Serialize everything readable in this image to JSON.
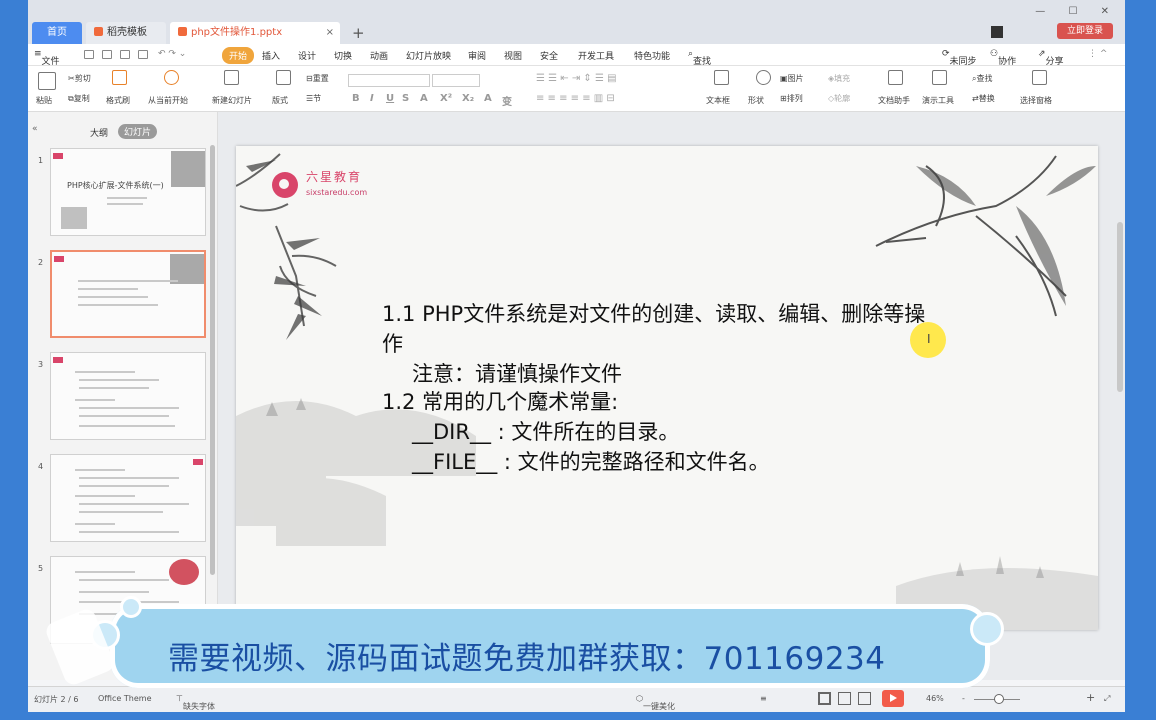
{
  "tabs": {
    "home": "首页",
    "template": "稻壳模板",
    "doc": "php文件操作1.pptx",
    "close": "×",
    "plus": "+"
  },
  "window": {
    "controls": "— ☐ ✕"
  },
  "login": "立即登录",
  "menu": {
    "file": "文件",
    "items": [
      "开始",
      "插入",
      "设计",
      "切换",
      "动画",
      "幻灯片放映",
      "审阅",
      "视图",
      "安全",
      "开发工具",
      "特色功能",
      "查找"
    ],
    "right": [
      "未同步",
      "协作",
      "分享"
    ]
  },
  "ribbon": {
    "paste": "粘贴",
    "cut": "剪切",
    "copy": "复制",
    "format_painter": "格式刷",
    "from_current": "从当前开始",
    "new_slide": "新建幻灯片",
    "layout": "版式",
    "reset": "重置",
    "section": "节",
    "font_buttons": [
      "B",
      "I",
      "U",
      "S",
      "A",
      "X²",
      "X₂",
      "A",
      "变"
    ],
    "textbox": "文本框",
    "shape": "形状",
    "picture": "图片",
    "fill": "填充",
    "arrange": "排列",
    "outline": "轮廓",
    "doc_assist": "文档助手",
    "presenter": "演示工具",
    "find": "查找",
    "replace": "替换",
    "select_pane": "选择窗格"
  },
  "leftpanel": {
    "collapse": "«",
    "outline_tab": "大纲",
    "slides_tab": "幻灯片"
  },
  "thumbs": [
    {
      "num": "1",
      "title": "PHP核心扩展-文件系统(一)"
    },
    {
      "num": "2"
    },
    {
      "num": "3"
    },
    {
      "num": "4"
    },
    {
      "num": "5"
    }
  ],
  "slide": {
    "logo_name": "六星教育",
    "logo_url": "sixstaredu.com",
    "line1": "1.1 PHP文件系统是对文件的创建、读取、编辑、删除等操",
    "line1b": "作",
    "line2": "注意：请谨慎操作文件",
    "line3": "1.2 常用的几个魔术常量:",
    "line4": "__DIR__ : 文件所在的目录。",
    "line5": "__FILE__ : 文件的完整路径和文件名。",
    "cursor": "I"
  },
  "banner": {
    "text": "需要视频、源码面试题免费加群获取：701169234"
  },
  "status": {
    "slide_count": "幻灯片 2 / 6",
    "theme": "Office Theme",
    "font_missing": "缺失字体",
    "beautify": "一键美化",
    "zoom": "46%",
    "minus": "-",
    "plus": "+"
  }
}
